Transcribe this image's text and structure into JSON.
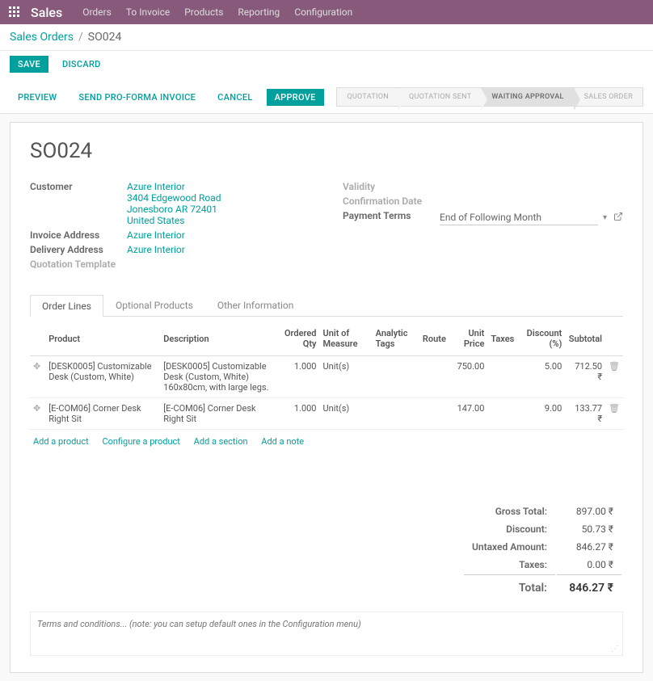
{
  "navbar": {
    "brand": "Sales",
    "menu": [
      "Orders",
      "To Invoice",
      "Products",
      "Reporting",
      "Configuration"
    ]
  },
  "breadcrumb": {
    "root": "Sales Orders",
    "current": "SO024"
  },
  "actions": {
    "save": "SAVE",
    "discard": "DISCARD"
  },
  "tab_actions": {
    "preview": "PREVIEW",
    "send_proforma": "SEND PRO-FORMA INVOICE",
    "cancel": "CANCEL",
    "approve": "APPROVE"
  },
  "status_steps": [
    "QUOTATION",
    "QUOTATION SENT",
    "WAITING APPROVAL",
    "SALES ORDER"
  ],
  "status_active_index": 2,
  "record": {
    "title": "SO024",
    "customer_label": "Customer",
    "customer_name": "Azure Interior",
    "customer_addr": [
      "3404 Edgewood Road",
      "Jonesboro AR 72401",
      "United States"
    ],
    "invoice_addr_label": "Invoice Address",
    "invoice_addr": "Azure Interior",
    "delivery_addr_label": "Delivery Address",
    "delivery_addr": "Azure Interior",
    "quotation_tmpl_label": "Quotation Template",
    "validity_label": "Validity",
    "confirm_date_label": "Confirmation Date",
    "payment_terms_label": "Payment Terms",
    "payment_terms_value": "End of Following Month"
  },
  "sheet_tabs": [
    "Order Lines",
    "Optional Products",
    "Other Information"
  ],
  "sheet_tab_active": 0,
  "table": {
    "headers": {
      "product": "Product",
      "description": "Description",
      "ordered_qty": "Ordered Qty",
      "uom": "Unit of Measure",
      "analytic": "Analytic Tags",
      "route": "Route",
      "unit_price": "Unit Price",
      "taxes": "Taxes",
      "discount": "Discount (%)",
      "subtotal": "Subtotal"
    },
    "rows": [
      {
        "product": "[DESK0005] Customizable Desk (Custom, White)",
        "description": "[DESK0005] Customizable Desk (Custom, White)\n160x80cm, with large legs.",
        "qty": "1.000",
        "uom": "Unit(s)",
        "analytic": "",
        "route": "",
        "price": "750.00",
        "taxes": "",
        "discount": "5.00",
        "subtotal": "712.50 ₹"
      },
      {
        "product": "[E-COM06] Corner Desk Right Sit",
        "description": "[E-COM06] Corner Desk Right Sit",
        "qty": "1.000",
        "uom": "Unit(s)",
        "analytic": "",
        "route": "",
        "price": "147.00",
        "taxes": "",
        "discount": "9.00",
        "subtotal": "133.77 ₹"
      }
    ],
    "add_links": {
      "product": "Add a product",
      "configure": "Configure a product",
      "section": "Add a section",
      "note": "Add a note"
    }
  },
  "totals": {
    "gross_label": "Gross Total:",
    "gross": "897.00 ₹",
    "discount_label": "Discount:",
    "discount": "50.73 ₹",
    "untaxed_label": "Untaxed Amount:",
    "untaxed": "846.27 ₹",
    "taxes_label": "Taxes:",
    "taxes": "0.00 ₹",
    "total_label": "Total:",
    "total": "846.27 ₹"
  },
  "terms_placeholder": "Terms and conditions... (note: you can setup default ones in the Configuration menu)"
}
